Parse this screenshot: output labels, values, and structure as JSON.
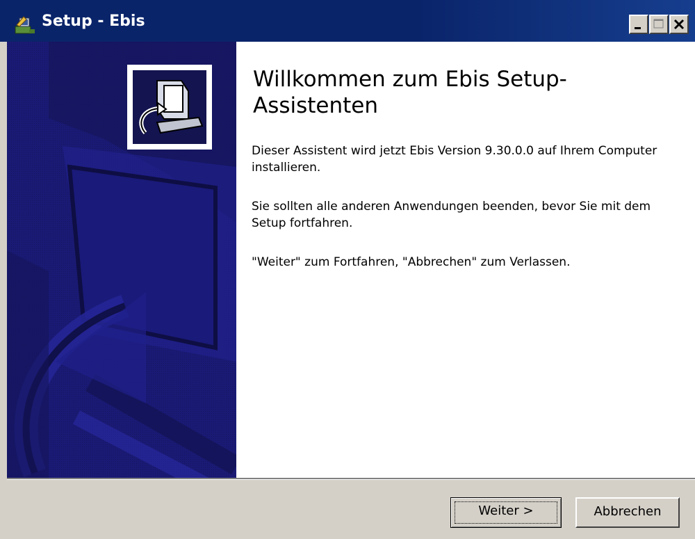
{
  "window": {
    "title": "Setup - Ebis",
    "icon": "setup-installer-icon"
  },
  "titlebar_buttons": {
    "minimize_icon": "minimize-icon",
    "maximize_icon": "maximize-icon",
    "close_icon": "close-icon"
  },
  "side_panel": {
    "logo_icon": "computer-install-icon"
  },
  "content": {
    "heading": "Willkommen zum Ebis Setup-Assistenten",
    "paragraph1": "Dieser Assistent wird jetzt Ebis Version 9.30.0.0 auf Ihrem Computer installieren.",
    "paragraph2": "Sie sollten alle anderen Anwendungen beenden, bevor Sie mit dem Setup fortfahren.",
    "paragraph3": "\"Weiter\" zum Fortfahren, \"Abbrechen\" zum Verlassen."
  },
  "buttons": {
    "next_label": "Weiter >",
    "cancel_label": "Abbrechen"
  },
  "colors": {
    "titlebar": "#0a246a",
    "side_panel": "#1a1a72",
    "dialog_face": "#d4d0c8"
  }
}
